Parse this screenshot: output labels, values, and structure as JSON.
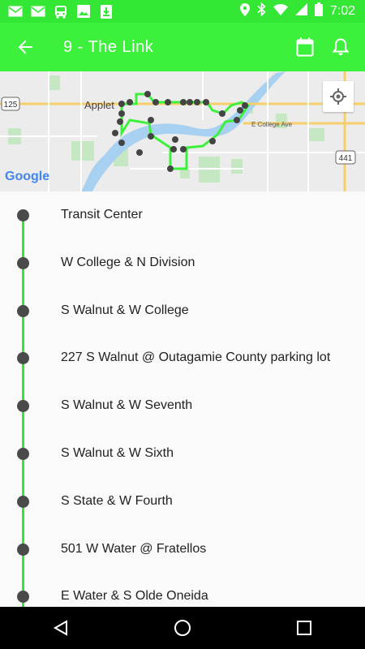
{
  "status_bar": {
    "time": "7:02",
    "icons": [
      "gmail-icon",
      "gmail-icon",
      "bus-icon",
      "image-icon",
      "download-icon",
      "location-icon",
      "bluetooth-icon",
      "wifi-icon",
      "signal-icon",
      "battery-icon"
    ]
  },
  "app_bar": {
    "title": "9 - The Link",
    "back_icon": "arrow-back-icon",
    "actions": [
      "calendar-icon",
      "bell-icon"
    ]
  },
  "map": {
    "logo": "Google",
    "labels": {
      "city": "Applet",
      "road": "E College Ave",
      "shield_125": "125",
      "shield_441": "441"
    },
    "locate_icon": "my-location-icon"
  },
  "stops": [
    {
      "name": "Transit Center"
    },
    {
      "name": "W College & N Division"
    },
    {
      "name": "S Walnut & W College"
    },
    {
      "name": "227 S Walnut @ Outagamie County parking lot"
    },
    {
      "name": "S Walnut & W Seventh"
    },
    {
      "name": "S Walnut & W Sixth"
    },
    {
      "name": "S State & W Fourth"
    },
    {
      "name": "501 W Water @ Fratellos"
    },
    {
      "name": "E Water & S Olde Oneida"
    }
  ],
  "colors": {
    "primary": "#3cf03c",
    "status_bar": "#34e734",
    "route_line": "#33e833",
    "stop_dot": "#4a4a4a"
  },
  "nav_bar": [
    "back-triangle-icon",
    "home-circle-icon",
    "recents-square-icon"
  ]
}
